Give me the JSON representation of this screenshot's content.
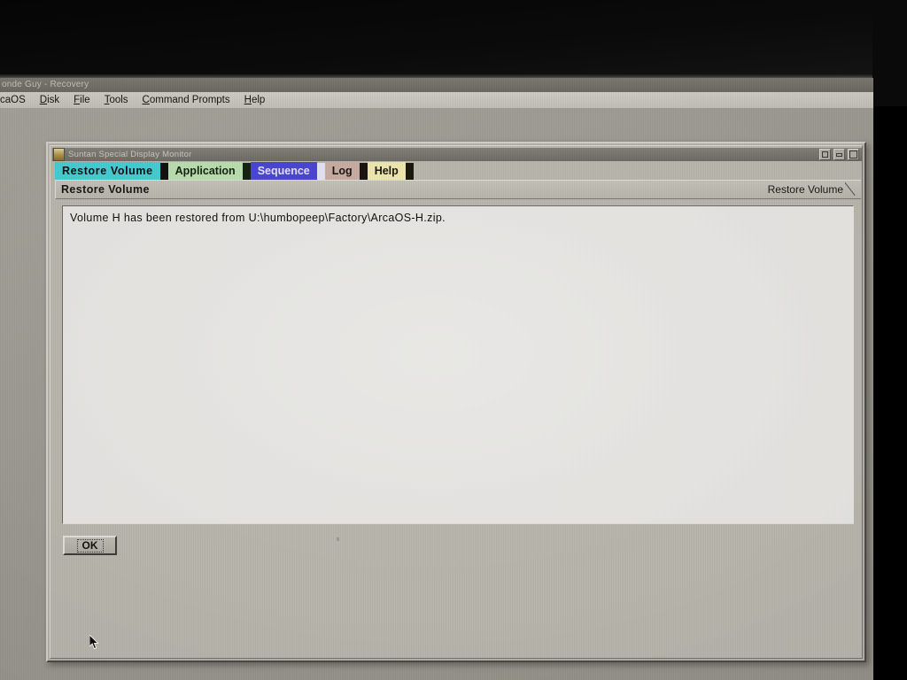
{
  "desktop": {
    "window_title": "onde Guy - Recovery",
    "menu": [
      {
        "label": "caOS",
        "mnemonic": ""
      },
      {
        "label": "Disk",
        "mnemonic": "D"
      },
      {
        "label": "File",
        "mnemonic": "F"
      },
      {
        "label": "Tools",
        "mnemonic": "T"
      },
      {
        "label": "Command Prompts",
        "mnemonic": "C"
      },
      {
        "label": "Help",
        "mnemonic": "H"
      }
    ]
  },
  "dialog": {
    "title": "Suntan Special Display Monitor",
    "sysmenu_icon": "application-icon",
    "window_buttons": [
      {
        "name": "hide-button",
        "glyph": "hide"
      },
      {
        "name": "minimize-button",
        "glyph": "minimize"
      },
      {
        "name": "maximize-button",
        "glyph": "maximize"
      }
    ],
    "tabs": [
      {
        "label": "Restore Volume",
        "color": "#45d3d8",
        "selected": true
      },
      {
        "label": "Application",
        "color": "#bfe5b5",
        "selected": false
      },
      {
        "label": "Sequence",
        "color": "#4a46d8",
        "selected": false
      },
      {
        "label": "Log",
        "color": "#cdb0a4",
        "selected": false
      },
      {
        "label": "Help",
        "color": "#f4eeb2",
        "selected": false
      }
    ],
    "page_header": {
      "left_title": "Restore Volume",
      "right_title": "Restore Volume"
    },
    "message_area": {
      "lines": [
        "Volume H has been restored from U:\\humbopeep\\Factory\\ArcaOS-H.zip."
      ]
    },
    "buttons": [
      {
        "label": "OK",
        "name": "ok-button",
        "focused": true
      }
    ]
  },
  "colors": {
    "desktop_background": "#9e9c92",
    "dialog_face": "#bdbbb1",
    "titlebar": "#78766e",
    "entryfield": "#f3f2ef",
    "text": "#111009"
  }
}
